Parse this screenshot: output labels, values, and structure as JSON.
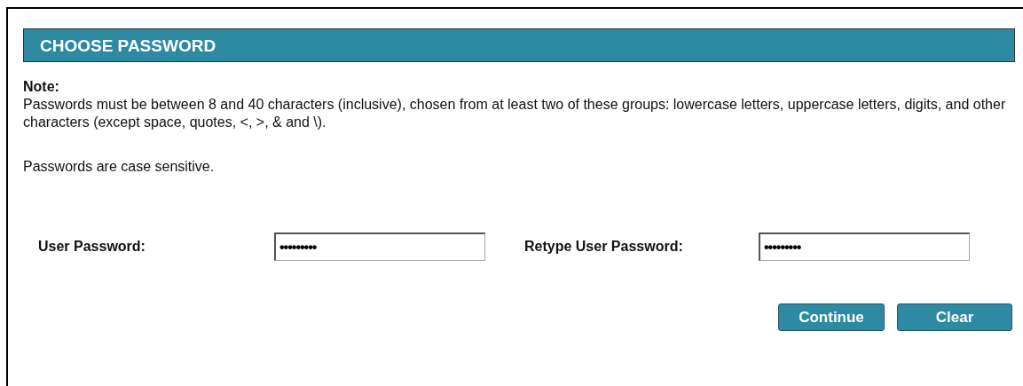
{
  "header": {
    "title": "CHOOSE PASSWORD"
  },
  "note": {
    "label": "Note:",
    "text": "Passwords must be between 8 and 40 characters (inclusive), chosen from at least two of these groups: lowercase letters, uppercase letters, digits, and other characters (except space, quotes, <, >, & and \\).",
    "case_note": "Passwords are case sensitive."
  },
  "fields": [
    {
      "label": "User Password:",
      "value": "•••••••••"
    },
    {
      "label": "Retype User Password:",
      "value": "•••••••••"
    }
  ],
  "buttons": [
    "Continue",
    "Clear"
  ]
}
